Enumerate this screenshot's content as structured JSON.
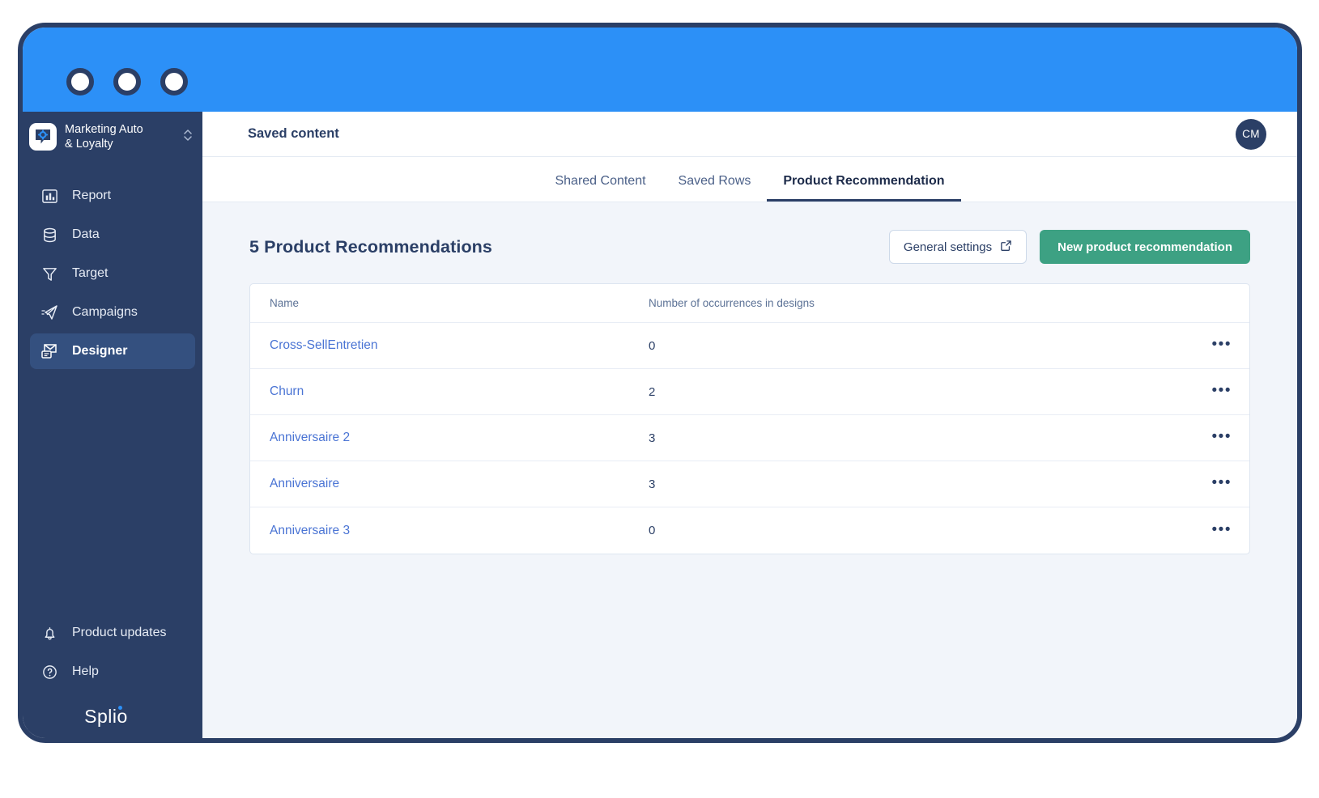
{
  "window": {
    "dots": [
      "window-dot-1",
      "window-dot-2",
      "window-dot-3"
    ],
    "titlebar_color": "#2c90f7",
    "frame_border_color": "#2b3f66"
  },
  "sidebar": {
    "workspace": {
      "name": "Marketing Auto\n& Loyalty",
      "icon": "gear-bubble-icon",
      "chevron": "chevron-updown-icon"
    },
    "items": [
      {
        "label": "Report",
        "icon": "bar-chart-icon",
        "active": false
      },
      {
        "label": "Data",
        "icon": "database-icon",
        "active": false
      },
      {
        "label": "Target",
        "icon": "funnel-icon",
        "active": false
      },
      {
        "label": "Campaigns",
        "icon": "paper-plane-icon",
        "active": false
      },
      {
        "label": "Designer",
        "icon": "envelope-design-icon",
        "active": true
      }
    ],
    "bottom_items": [
      {
        "label": "Product updates",
        "icon": "bell-icon"
      },
      {
        "label": "Help",
        "icon": "question-circle-icon"
      }
    ],
    "brand": "Splio",
    "background_color": "#2b3f66",
    "active_item_color": "#34507f"
  },
  "topbar": {
    "title": "Saved content",
    "avatar_initials": "CM"
  },
  "tabs": [
    {
      "label": "Shared Content",
      "active": false
    },
    {
      "label": "Saved Rows",
      "active": false
    },
    {
      "label": "Product Recommendation",
      "active": true
    }
  ],
  "main": {
    "heading": "5 Product Recommendations",
    "buttons": {
      "general_settings": "General settings",
      "general_settings_icon": "external-link-icon",
      "new_recommendation": "New product recommendation",
      "primary_color": "#3da183"
    },
    "table": {
      "columns": [
        "Name",
        "Number of occurrences in designs"
      ],
      "row_action_icon": "ellipsis-horizontal-icon",
      "rows": [
        {
          "name": "Cross-SellEntretien",
          "occurrences": "0"
        },
        {
          "name": "Churn",
          "occurrences": "2"
        },
        {
          "name": "Anniversaire 2",
          "occurrences": "3"
        },
        {
          "name": "Anniversaire",
          "occurrences": "3"
        },
        {
          "name": "Anniversaire 3",
          "occurrences": "0"
        }
      ]
    }
  }
}
